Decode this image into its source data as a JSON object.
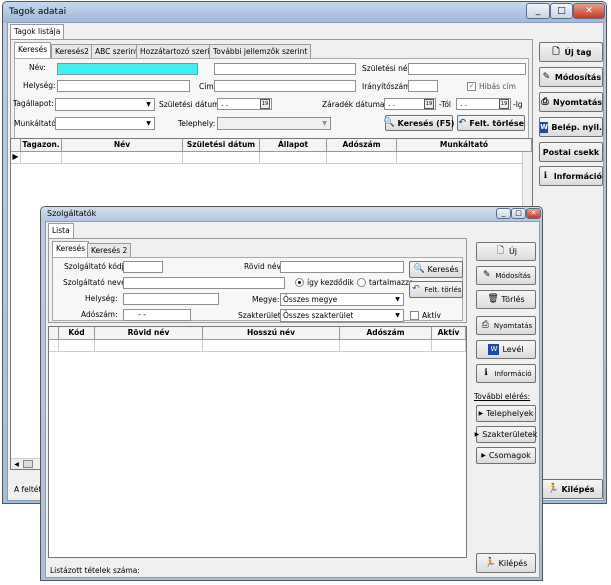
{
  "main_window": {
    "title": "Tagok adatai",
    "tab": "Tagok listája",
    "search_tabs": [
      "Keresés",
      "Keresés2",
      "ABC szerint",
      "Hozzátartozó szerint",
      "További jellemzők szerint"
    ],
    "fields": {
      "nev": "Név:",
      "szuletesi_nev": "Születési név:",
      "helyseg": "Helység:",
      "cim": "Cím:",
      "iranyitoszam": "Irányítószám:",
      "hibas_cim": "Hibás cím",
      "tagallapot": "Tagállapot:",
      "szuletesi_datum": "Születési dátum:",
      "szuletesi_datum_value": ". .",
      "zaradek_datuma": "Záradék dátuma:",
      "zaradek_tol_value": ". .",
      "tol": "-Tól",
      "zaradek_ig_value": ". .",
      "ig": "-Ig",
      "munkaltato": "Munkáltató:",
      "telephely": "Telephely:"
    },
    "buttons": {
      "kereses": "Keresés (F5)",
      "felt_torlese": "Felt. törlése"
    },
    "columns": [
      "Tagazon.",
      "Név",
      "Születési dátum",
      "Állapot",
      "Adószám",
      "Munkáltató"
    ],
    "side_buttons": [
      "Új tag",
      "Módosítás",
      "Nyomtatás",
      "Belép. nyil.",
      "Postai csekk",
      "Információ"
    ],
    "kilepes": "Kilépés",
    "status_left": "A feltét"
  },
  "child_window": {
    "title": "Szolgáltatók",
    "tab": "Lista",
    "search_tabs": [
      "Keresés",
      "Keresés 2"
    ],
    "fields": {
      "kod": "Szolgáltató kódja:",
      "rovid_nev": "Rövid név:",
      "neve": "Szolgáltató neve:",
      "igy_kezdodik": "így kezdődik",
      "tartalmazza": "tartalmazza",
      "helyseg": "Helység:",
      "megye": "Megye:",
      "megye_value": "Összes megye",
      "adoszam": "Adószám:",
      "adoszam_value": "-   -",
      "szakterulet": "Szakterület:",
      "szakterulet_value": "Összes szakterület",
      "aktiv": "Aktív"
    },
    "buttons": {
      "kereses": "Keresés",
      "felt_torles": "Felt. törlés"
    },
    "columns": [
      "Kód",
      "Rövid név",
      "Hosszú név",
      "Adószám",
      "Aktív"
    ],
    "side_buttons": [
      "Új",
      "Módosítás",
      "Törlés",
      "Nyomtatás",
      "Levél",
      "Információ"
    ],
    "tovabbi_eleres": "További elérés:",
    "links": [
      "Telephelyek",
      "Szakterületek",
      "Csomagok"
    ],
    "kilepes": "Kilépés",
    "status": "Listázott tételek száma:"
  },
  "colors": {
    "highlight_input": "#3ef0f0",
    "titlebar": "#b4cbe6",
    "close_button": "#c43a20"
  }
}
